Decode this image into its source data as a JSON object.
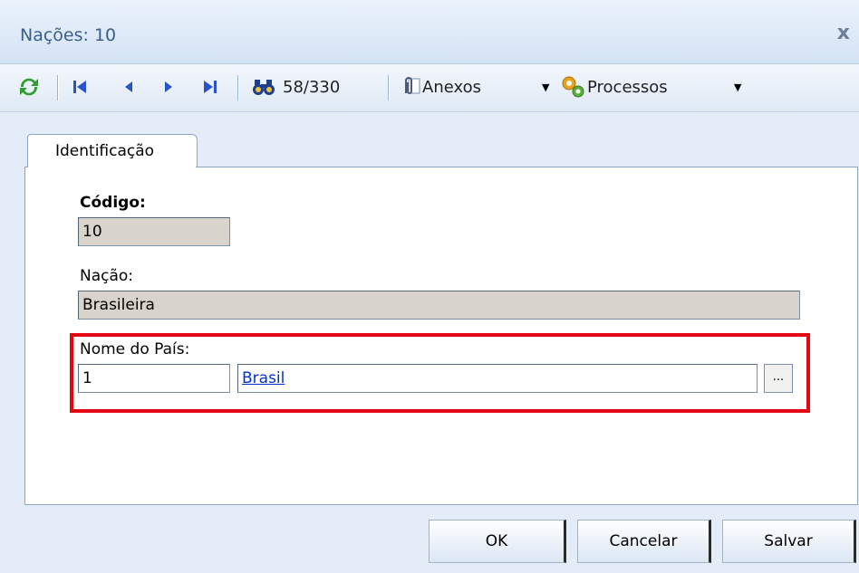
{
  "window": {
    "title": "Nações: 10",
    "close_icon": "close-icon"
  },
  "toolbar": {
    "record_counter": "58/330",
    "attachments_label": "Anexos",
    "processes_label": "Processos",
    "icons": [
      "refresh-icon",
      "first-record-icon",
      "previous-record-icon",
      "next-record-icon",
      "last-record-icon",
      "binoculars-icon",
      "paperclip-icon",
      "dropdown-arrow-icon",
      "gears-icon"
    ]
  },
  "tabs": [
    {
      "label": "Identificação",
      "selected": true
    }
  ],
  "form": {
    "code_label": "Código:",
    "code_value": "10",
    "nation_label": "Nação:",
    "nation_value": "Brasileira",
    "country_label": "Nome do País:",
    "country_code": "1",
    "country_name": "Brasil",
    "lookup_label": "..."
  },
  "footer": {
    "ok_label": "OK",
    "cancel_label": "Cancelar",
    "save_label": "Salvar"
  },
  "colors": {
    "highlight": "#e30613",
    "link": "#0033cc",
    "readonly_field": "#d8d3cb",
    "title_text": "#3b5e8f"
  }
}
